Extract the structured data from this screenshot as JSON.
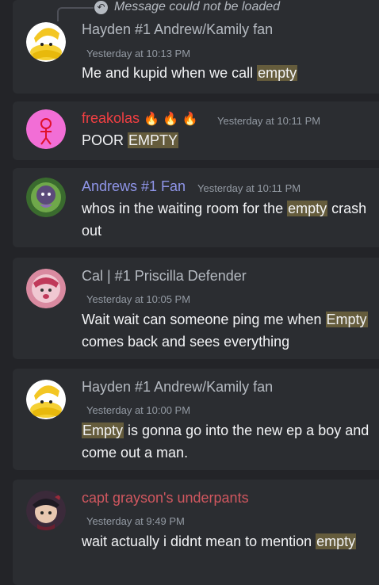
{
  "reply_preview": {
    "text": "Message could not be loaded",
    "icon": "reply-arrow-icon"
  },
  "messages": [
    {
      "author": "Hayden #1 Andrew/Kamily fan",
      "author_color": "#b5bac1",
      "timestamp": "Yesterday at 10:13 PM",
      "avatar": "banana-cat-avatar",
      "segments": [
        {
          "text": "Me and kupid when we call ",
          "hl": false
        },
        {
          "text": "empty",
          "hl": true
        }
      ]
    },
    {
      "author": "freakolas",
      "author_color": "#f23f42",
      "author_emojis": "🔥 🔥 🔥",
      "timestamp": "Yesterday at 10:11 PM",
      "avatar": "pink-stick-figure-avatar",
      "segments": [
        {
          "text": "POOR ",
          "hl": false
        },
        {
          "text": "EMPTY",
          "hl": true
        }
      ]
    },
    {
      "author": "Andrews #1 Fan",
      "author_color": "#8f95e8",
      "timestamp": "Yesterday at 10:11 PM",
      "avatar": "wreath-character-avatar",
      "segments": [
        {
          "text": "whos in the waiting room for the ",
          "hl": false
        },
        {
          "text": "empty",
          "hl": true
        },
        {
          "text": " crash out",
          "hl": false
        }
      ]
    },
    {
      "author": "Cal | #1 Priscilla Defender",
      "author_color": "#b5bac1",
      "timestamp": "Yesterday at 10:05 PM",
      "avatar": "pink-character-avatar",
      "segments": [
        {
          "text": "Wait wait can someone ping me when ",
          "hl": false
        },
        {
          "text": "Empty",
          "hl": true
        },
        {
          "text": " comes back and sees everything",
          "hl": false
        }
      ]
    },
    {
      "author": "Hayden #1 Andrew/Kamily fan",
      "author_color": "#b5bac1",
      "timestamp": "Yesterday at 10:00 PM",
      "avatar": "banana-cat-avatar",
      "segments": [
        {
          "text": "Empty",
          "hl": true
        },
        {
          "text": " is gonna go into the new ep a boy and come out a man.",
          "hl": false
        }
      ]
    },
    {
      "author": "capt grayson's underpants",
      "author_color": "#d0575f",
      "timestamp": "Yesterday at 9:49 PM",
      "avatar": "pirate-character-avatar",
      "segments": [
        {
          "text": "wait actually i didnt mean to mention ",
          "hl": false
        },
        {
          "text": "empty",
          "hl": true
        }
      ]
    }
  ]
}
